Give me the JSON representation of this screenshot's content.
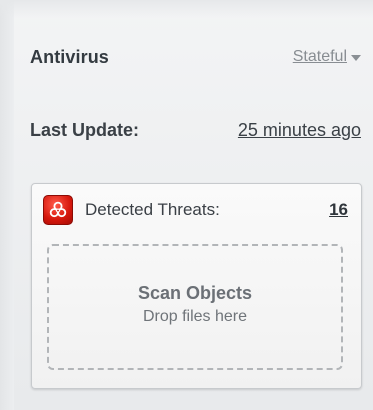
{
  "antivirus": {
    "title": "Antivirus",
    "state_label": "Stateful"
  },
  "last_update": {
    "label": "Last Update:",
    "value": "25 minutes ago"
  },
  "threats": {
    "label": "Detected Threats:",
    "count": "16",
    "icon": "biohazard-icon",
    "icon_color": "#d5170c"
  },
  "drop_zone": {
    "title": "Scan Objects",
    "hint": "Drop files here"
  }
}
